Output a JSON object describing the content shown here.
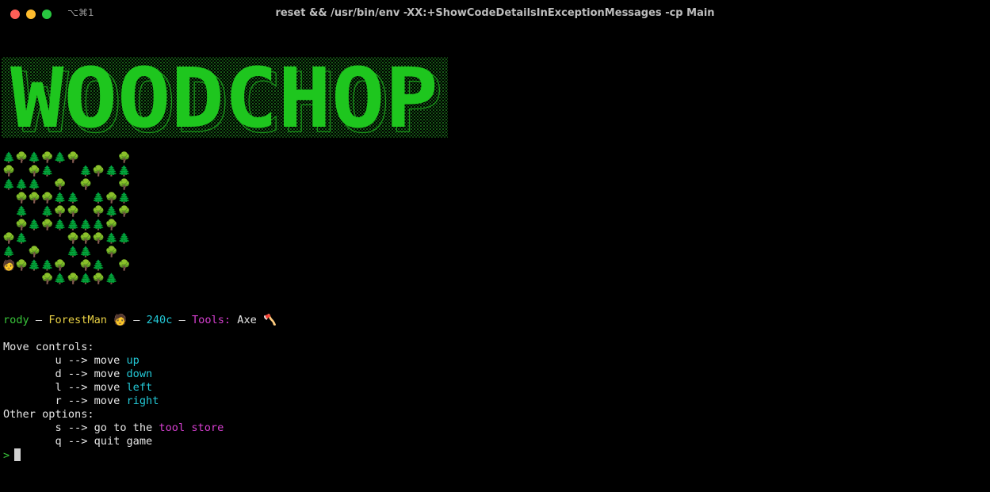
{
  "window": {
    "shortcut": "⌥⌘1",
    "title": "reset && /usr/bin/env  -XX:+ShowCodeDetailsInExceptionMessages -cp  Main"
  },
  "banner": {
    "text": "WOODCHOP",
    "color": "#1ec61e"
  },
  "forest": {
    "rows": [
      "P T P T P T . . . T",
      "T . T P . . P T P P",
      "P P P . T . T . . T",
      ". T T T P P . P T P",
      ". P . P T T . T P T",
      ". T P T P P P P T .",
      "T P . . . T T T P P",
      "P . T . . P P . T .",
      "M T P P T . T P . T",
      ". . . T P T P T P ."
    ],
    "legend": {
      "T": "🌳",
      "P": "🌲",
      "M": "🧑",
      ".": " "
    }
  },
  "status": {
    "name": "rody",
    "sep1": " – ",
    "role": "ForestMan",
    "role_icon": "🧑",
    "sep2": " – ",
    "coins": "240c",
    "sep3": " – ",
    "tools_label": "Tools:",
    "tools_value": "Axe",
    "tool_icon": "🪓"
  },
  "menu": {
    "move_header": "Move controls:",
    "moves": [
      {
        "prefix": "        u --> move ",
        "word": "up"
      },
      {
        "prefix": "        d --> move ",
        "word": "down"
      },
      {
        "prefix": "        l --> move ",
        "word": "left"
      },
      {
        "prefix": "        r --> move ",
        "word": "right"
      }
    ],
    "other_header": "Other options:",
    "store": {
      "prefix": "        s --> go to the ",
      "word": "tool store"
    },
    "quit": "        q --> quit game"
  },
  "prompt": {
    "symbol": ">"
  }
}
